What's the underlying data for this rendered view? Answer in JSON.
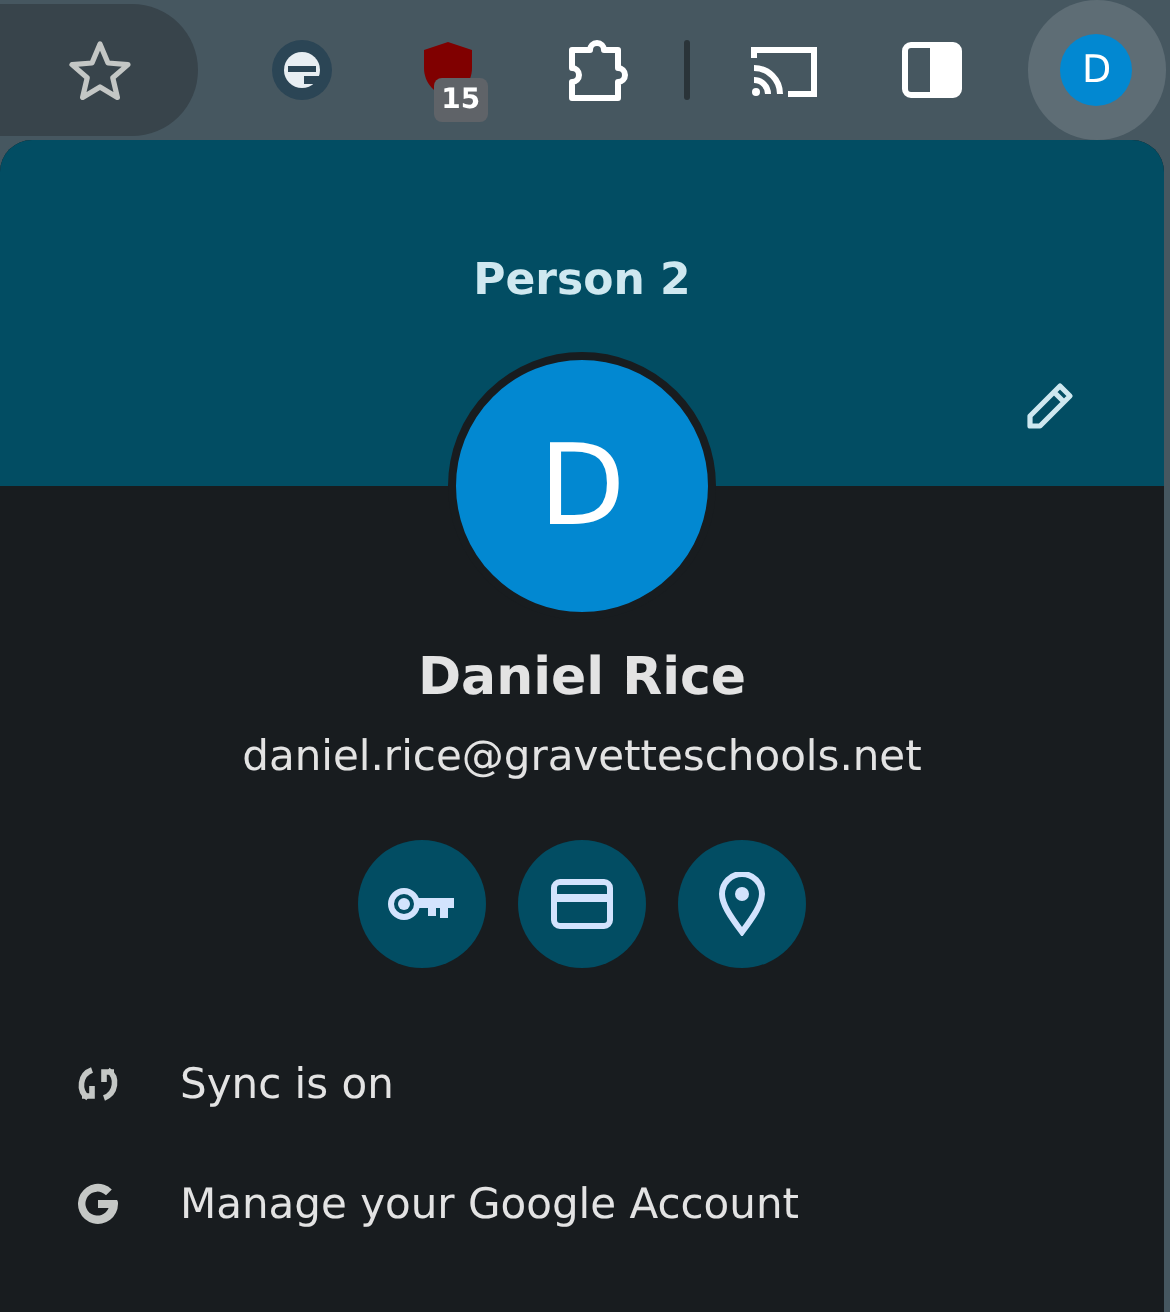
{
  "toolbar": {
    "extension_badge": "15",
    "avatar_letter": "D"
  },
  "profile": {
    "title": "Person 2",
    "avatar_letter": "D",
    "name": "Daniel Rice",
    "email": "daniel.rice@gravetteschools.net"
  },
  "quick_actions": [
    {
      "kind": "passwords"
    },
    {
      "kind": "payments"
    },
    {
      "kind": "addresses"
    }
  ],
  "menu": [
    {
      "kind": "sync",
      "label": "Sync is on"
    },
    {
      "kind": "google",
      "label": "Manage your Google Account"
    }
  ]
}
